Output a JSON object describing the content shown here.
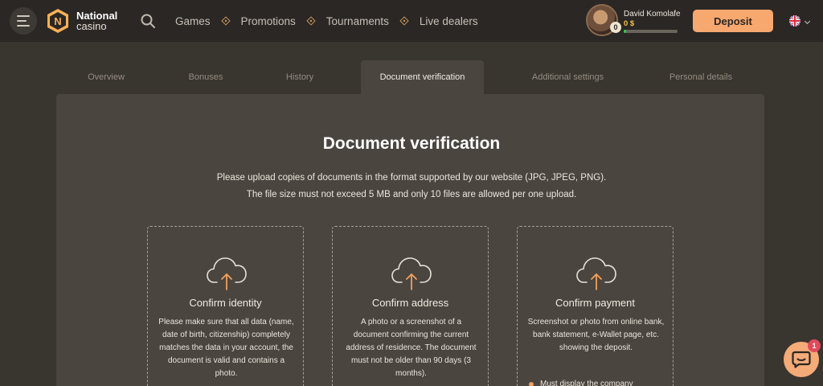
{
  "header": {
    "brand": {
      "name": "National",
      "sub": "casino",
      "badge_letter": "N"
    },
    "nav": [
      {
        "label": "Games"
      },
      {
        "label": "Promotions"
      },
      {
        "label": "Tournaments"
      },
      {
        "label": "Live dealers"
      }
    ],
    "user": {
      "name": "David Komolafe",
      "level": "0",
      "balance": "0 $",
      "progress": 0.05
    },
    "deposit_label": "Deposit",
    "language_icon": "uk-flag-icon"
  },
  "tabs": [
    {
      "label": "Overview",
      "active": false
    },
    {
      "label": "Bonuses",
      "active": false
    },
    {
      "label": "History",
      "active": false
    },
    {
      "label": "Document verification",
      "active": true
    },
    {
      "label": "Additional settings",
      "active": false
    },
    {
      "label": "Personal details",
      "active": false
    }
  ],
  "main": {
    "title": "Document verification",
    "description_line1": "Please upload copies of documents in the format supported by our website (JPG, JPEG, PNG).",
    "description_line2": "The file size must not exceed 5 MB and only 10 files are allowed per one upload.",
    "cards": [
      {
        "title": "Confirm identity",
        "text": "Please make sure that all data (name, date of birth, citizenship) completely matches the data in your account, the document is valid and contains a photo."
      },
      {
        "title": "Confirm address",
        "text": "A photo or a screenshot of a document confirming the current address of residence. The document must not be older than 90 days (3 months)."
      },
      {
        "title": "Confirm payment",
        "text": "Screenshot or photo from online bank, bank statement, e-Wallet page, etc. showing the deposit.",
        "bullet": "Must display the company"
      }
    ]
  },
  "chat": {
    "badge": "1"
  },
  "colors": {
    "accent": "#f7a86f",
    "background": "#39352f",
    "panel": "#4a453f",
    "header": "#2a2725"
  }
}
